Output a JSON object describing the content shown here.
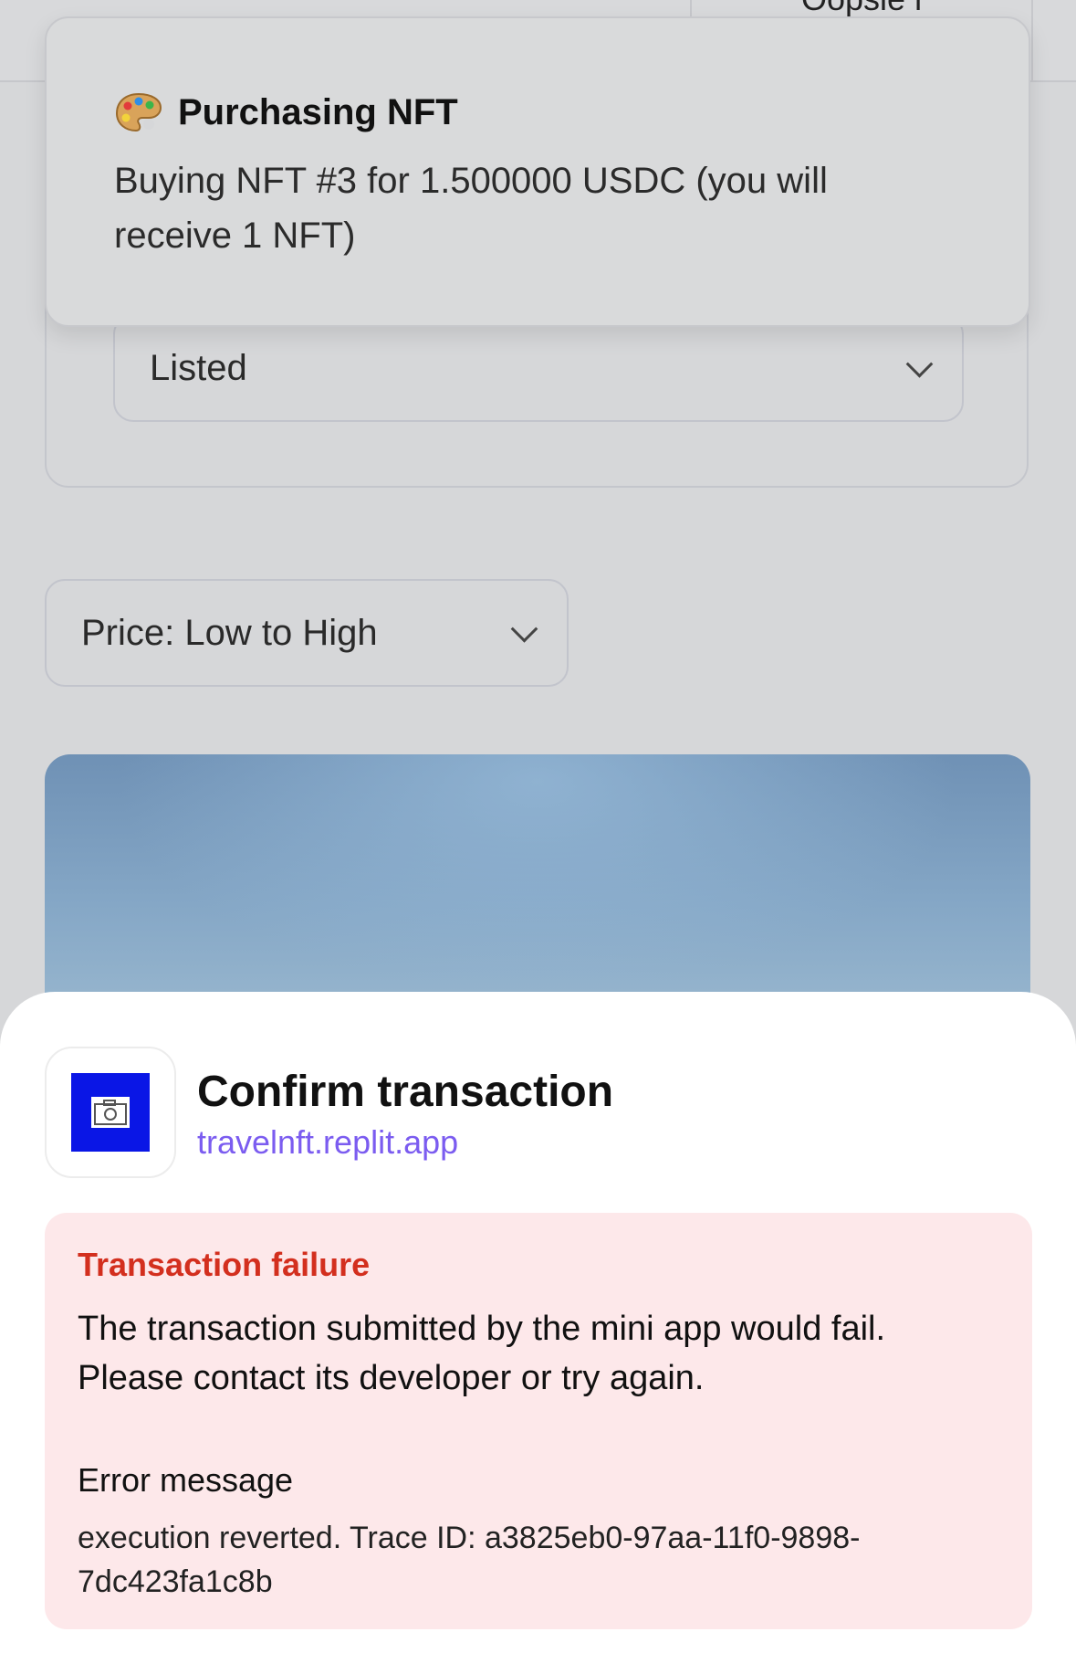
{
  "header": {
    "partial_text": "Oopsie i"
  },
  "toast": {
    "icon": "palette-icon",
    "title": "Purchasing NFT",
    "message": "Buying NFT #3 for 1.500000 USDC (you will receive 1 NFT)"
  },
  "filters": {
    "status_value": "Listed",
    "sort_value": "Price: Low to High"
  },
  "sheet": {
    "app_icon": "camera-icon",
    "title": "Confirm transaction",
    "domain": "travelnft.replit.app",
    "error": {
      "title": "Transaction failure",
      "description": "The transaction submitted by the mini app would fail. Please contact its developer or try again.",
      "message_label": "Error message",
      "message": "execution reverted. Trace ID: a3825eb0-97aa-11f0-9898-7dc423fa1c8b"
    }
  },
  "colors": {
    "error_red": "#d32f1e",
    "error_bg": "#fde8ea",
    "domain_purple": "#7b5cf0",
    "app_icon_blue": "#0a16e6"
  }
}
